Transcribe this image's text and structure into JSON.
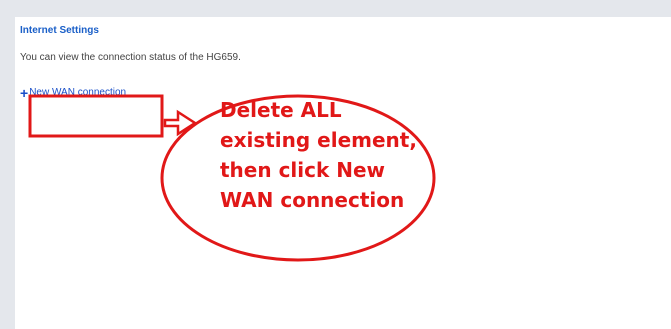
{
  "page": {
    "title": "Internet Settings",
    "description": "You can view the connection status of the HG659.",
    "new_wan_label": "New WAN connection"
  },
  "annotation": {
    "lines": [
      "Delete ALL",
      "existing element,",
      "then click New",
      "WAN connection"
    ],
    "color": "#e11818"
  },
  "icons": {
    "add": "plus-icon"
  }
}
